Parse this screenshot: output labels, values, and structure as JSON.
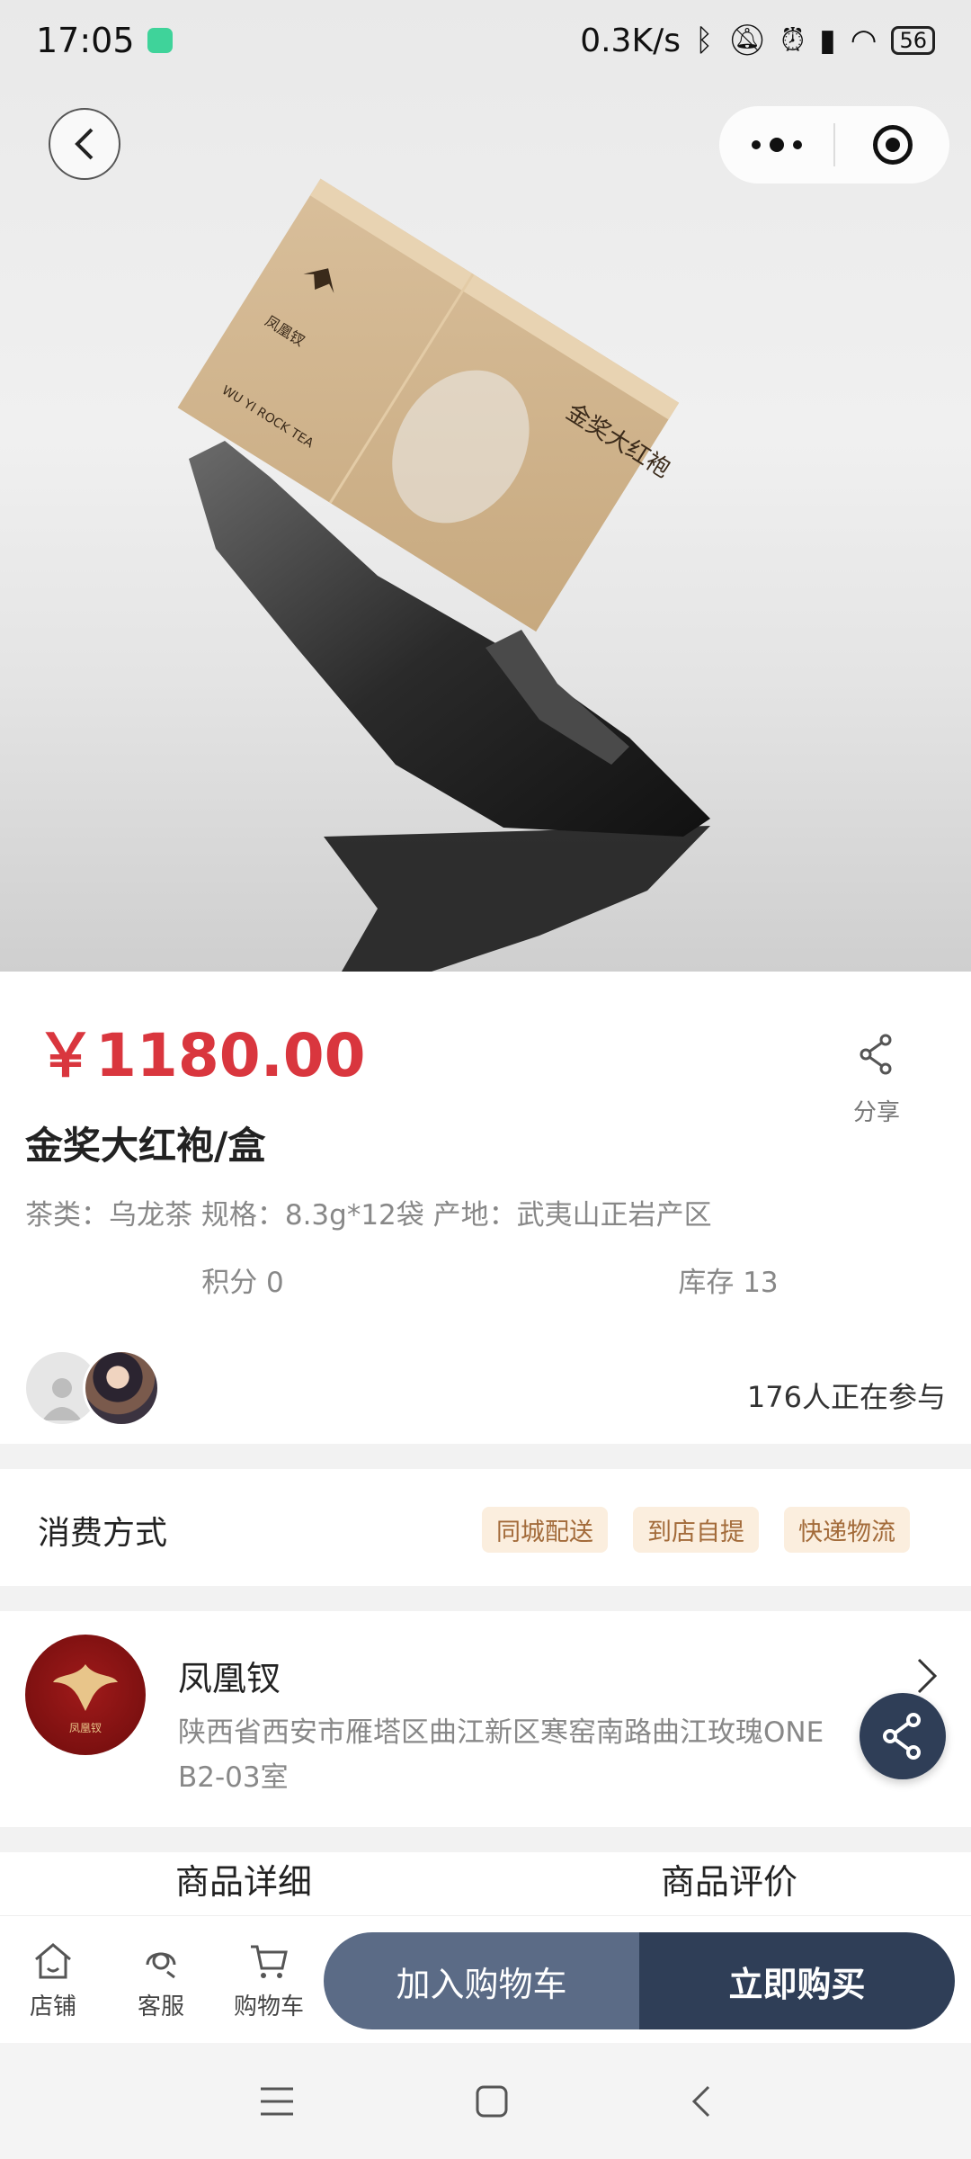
{
  "status_bar": {
    "time": "17:05",
    "network_speed": "0.3K/s",
    "battery": "56",
    "icons": [
      "bluetooth-icon",
      "bell-off-icon",
      "alarm-icon",
      "signal-icon",
      "wifi-icon",
      "battery-icon"
    ]
  },
  "header": {
    "back_icon": "chevron-left-icon",
    "more_icon": "more-dots-icon",
    "close_icon": "target-icon"
  },
  "product": {
    "price": "￥1180.00",
    "title": "金奖大红袍/盒",
    "specs": "茶类：乌龙茶 规格：8.3g*12袋 产地：武夷山正岩产区",
    "points": "积分 0",
    "stock": "库存 13",
    "participants": "176人正在参与",
    "share_label": "分享",
    "image_text": {
      "box_brand": "凤凰钗",
      "box_title": "金奖大红袍",
      "box_sub": "WU YI ROCK TEA"
    }
  },
  "consume": {
    "label": "消费方式",
    "tags": [
      "同城配送",
      "到店自提",
      "快递物流"
    ]
  },
  "store": {
    "logo_text": "凤凰钗",
    "name": "凤凰钗",
    "address": "陕西省西安市雁塔区曲江新区寒窑南路曲江玫瑰ONE B2-03室"
  },
  "tabs": [
    "商品详细",
    "商品评价"
  ],
  "bottom_nav": {
    "shop": "店铺",
    "service": "客服",
    "cart": "购物车",
    "add_to_cart": "加入购物车",
    "buy_now": "立即购买"
  },
  "colors": {
    "price": "#d9363e",
    "primary_dark": "#2f3e57",
    "primary_light": "#5b6b86",
    "tag_bg": "#fbeede",
    "tag_text": "#a36b3a"
  }
}
